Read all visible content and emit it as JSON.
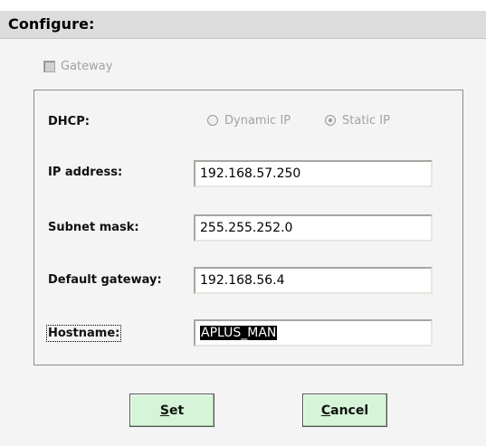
{
  "header": {
    "title": "Configure:"
  },
  "gateway_checkbox": {
    "label": "Gateway",
    "checked": false,
    "enabled": false
  },
  "dhcp": {
    "label": "DHCP:",
    "options": [
      {
        "label": "Dynamic IP",
        "checked": false
      },
      {
        "label": "Static IP",
        "checked": true
      }
    ]
  },
  "fields": {
    "ip": {
      "label": "IP address:",
      "value": "192.168.57.250"
    },
    "subnet": {
      "label": "Subnet mask:",
      "value": "255.255.252.0"
    },
    "gateway": {
      "label": "Default gateway:",
      "value": "192.168.56.4"
    },
    "hostname": {
      "label": "Hostname:",
      "value": "APLUS_MAN"
    }
  },
  "buttons": {
    "set": {
      "accel": "S",
      "rest": "et"
    },
    "cancel": {
      "accel": "C",
      "rest": "ancel"
    }
  },
  "colors": {
    "header_bg": "#dcdcdc",
    "panel_bg": "#f4f4f4",
    "button_bg": "#d6f5d8",
    "disabled_text": "#a0a0a0"
  }
}
